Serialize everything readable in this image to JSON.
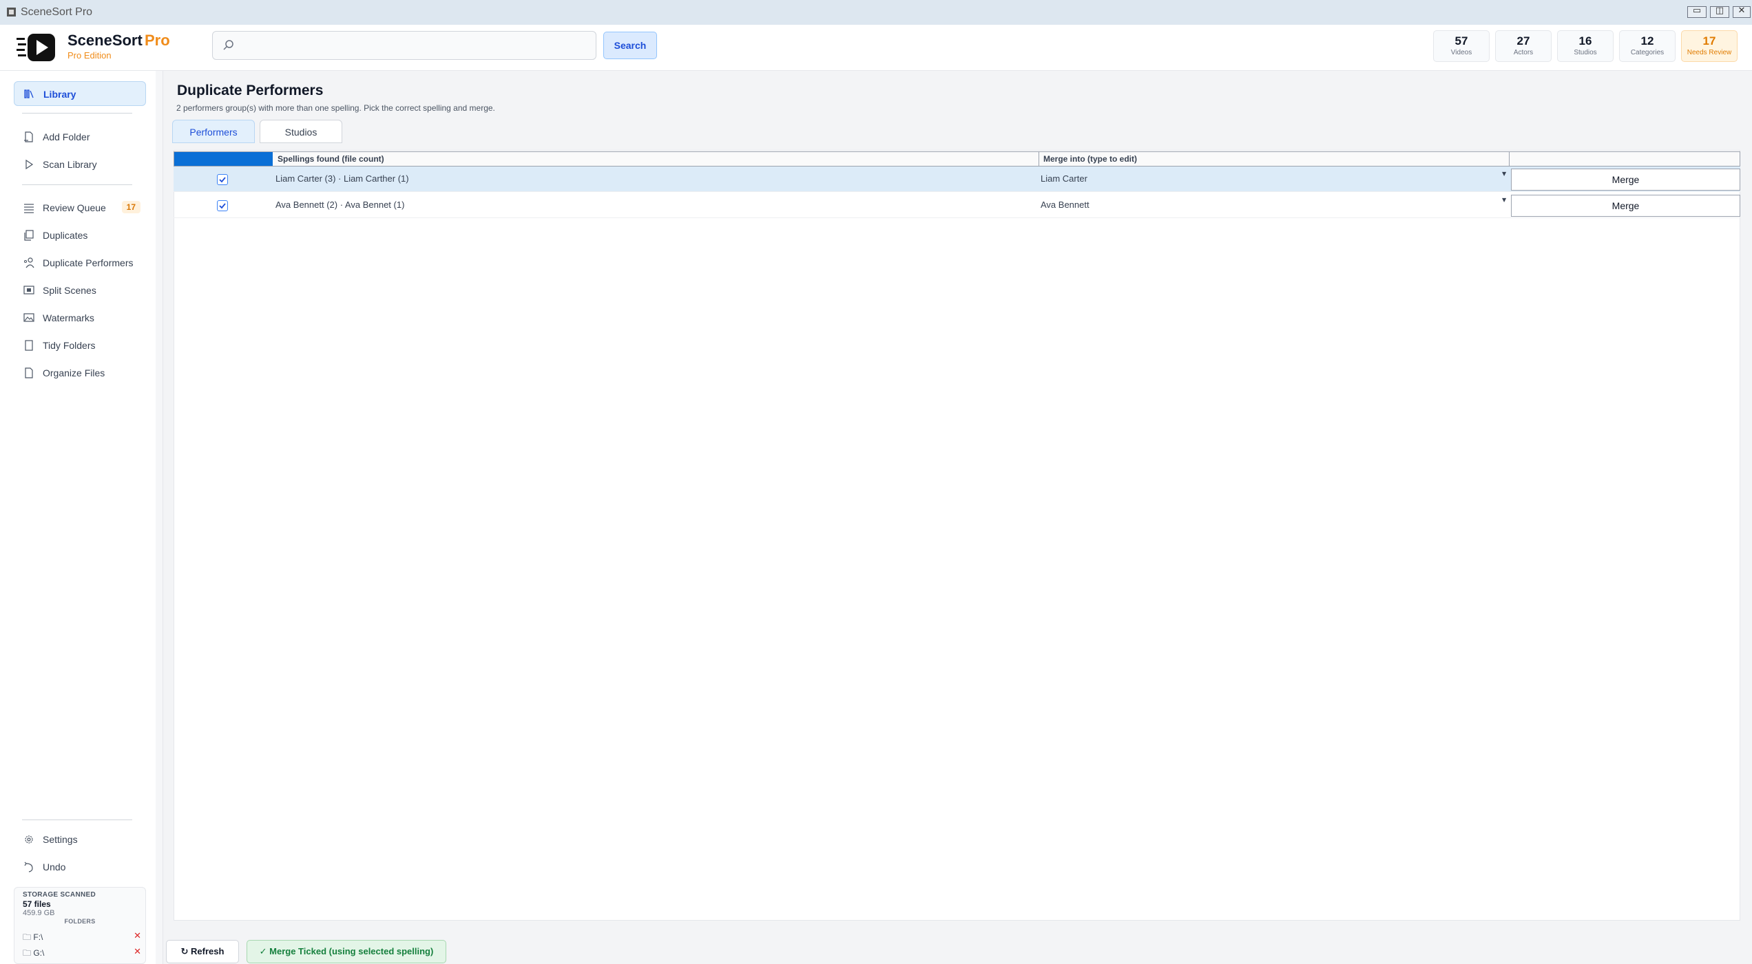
{
  "window": {
    "title": "SceneSort Pro"
  },
  "header": {
    "brand": "SceneSort",
    "brand_pro": "Pro",
    "edition": "Pro Edition",
    "search_placeholder": "",
    "search_label": "Search",
    "stats": [
      {
        "value": "57",
        "label": "Videos"
      },
      {
        "value": "27",
        "label": "Actors"
      },
      {
        "value": "16",
        "label": "Studios"
      },
      {
        "value": "12",
        "label": "Categories"
      },
      {
        "value": "17",
        "label": "Needs Review"
      }
    ]
  },
  "sidebar": {
    "items": [
      {
        "label": "Library",
        "icon": "library-icon"
      },
      {
        "label": "Add Folder",
        "icon": "add-folder-icon"
      },
      {
        "label": "Scan Library",
        "icon": "play-icon"
      },
      {
        "label": "Review Queue",
        "icon": "list-icon",
        "badge": "17"
      },
      {
        "label": "Duplicates",
        "icon": "copy-icon"
      },
      {
        "label": "Duplicate Performers",
        "icon": "people-icon"
      },
      {
        "label": "Split Scenes",
        "icon": "film-icon"
      },
      {
        "label": "Watermarks",
        "icon": "image-icon"
      },
      {
        "label": "Tidy Folders",
        "icon": "folder-icon"
      },
      {
        "label": "Organize Files",
        "icon": "file-icon"
      },
      {
        "label": "Settings",
        "icon": "gear-icon"
      },
      {
        "label": "Undo",
        "icon": "undo-icon"
      }
    ],
    "storage": {
      "title": "STORAGE SCANNED",
      "files": "57 files",
      "size": "459.9 GB",
      "folders_title": "FOLDERS",
      "folders": [
        {
          "path": "F:\\",
          "remove": "✕"
        },
        {
          "path": "G:\\",
          "remove": "✕"
        }
      ]
    }
  },
  "main": {
    "title": "Duplicate Performers",
    "subtitle": "2 performers group(s) with more than one spelling. Pick the correct spelling and merge.",
    "tabs": [
      {
        "label": "Performers"
      },
      {
        "label": "Studios"
      }
    ],
    "columns": [
      "Spellings found (file count)",
      "Merge into (type to edit)"
    ],
    "rows": [
      {
        "spellings": "Liam Carter (3)  ·  Liam Carther (1)",
        "merge_into": "Liam Carter",
        "checked": true,
        "button": "Merge"
      },
      {
        "spellings": "Ava Bennett (2)  ·  Ava Bennet (1)",
        "merge_into": "Ava Bennett",
        "checked": true,
        "button": "Merge"
      }
    ]
  },
  "footer": {
    "refresh": "↻ Refresh",
    "merge_ticked": "✓ Merge Ticked (using selected spelling)"
  },
  "colors": {
    "accent": "#1d4ed8",
    "brand_orange": "#f08c1a",
    "success": "#15803d",
    "selection": "#0a6fd6"
  }
}
